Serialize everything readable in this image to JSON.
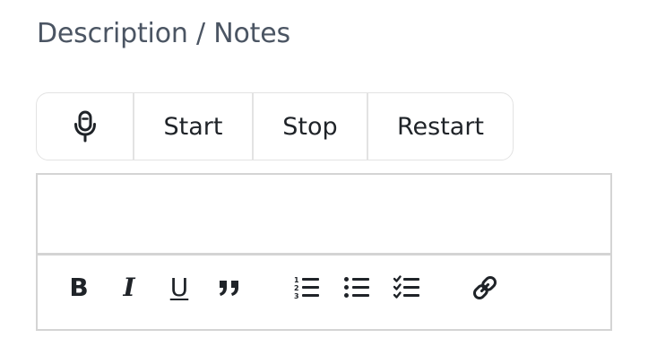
{
  "section": {
    "title": "Description / Notes"
  },
  "dictation": {
    "mic_icon": "microphone-icon",
    "start_label": "Start",
    "stop_label": "Stop",
    "restart_label": "Restart"
  },
  "editor": {
    "content": "",
    "toolbar": {
      "bold_label": "B",
      "italic_label": "I",
      "underline_label": "U",
      "icons": [
        "quote-icon",
        "ordered-list-icon",
        "bullet-list-icon",
        "checklist-icon",
        "link-icon"
      ]
    }
  },
  "colors": {
    "text": "#1f2328",
    "label": "#4b5563",
    "border": "#d4d4d4"
  }
}
